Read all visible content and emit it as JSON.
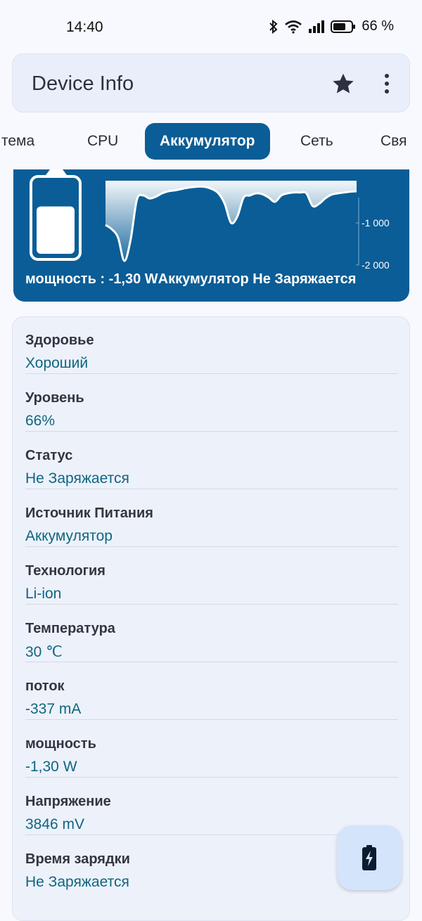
{
  "status_bar": {
    "time": "14:40",
    "battery_percent": "66 %",
    "icons": [
      "bluetooth-icon",
      "wifi-icon",
      "signal-icon",
      "battery-icon"
    ]
  },
  "app_bar": {
    "title": "Device Info",
    "actions": [
      "star-icon",
      "more-vert-icon"
    ]
  },
  "tabs": [
    {
      "label": "Система",
      "visible_label": "тема",
      "active": false
    },
    {
      "label": "CPU",
      "active": false
    },
    {
      "label": "Аккумулятор",
      "active": true
    },
    {
      "label": "Сеть",
      "active": false
    },
    {
      "label": "Связь",
      "visible_label": "Свя",
      "active": false
    }
  ],
  "battery_chart": {
    "battery_level": 0.66,
    "caption": "мощность : -1,30 WАккумулятор Не Заряжается",
    "colors": {
      "background": "#0a5d96",
      "line": "#ffffff"
    }
  },
  "chart_data": {
    "type": "area",
    "title": "",
    "xlabel": "",
    "ylabel": "",
    "ylim": [
      -2000,
      0
    ],
    "yticks": [
      {
        "value": -1000,
        "label": "-1 000"
      },
      {
        "value": -2000,
        "label": "-2 000"
      }
    ],
    "x": [
      0,
      1,
      2,
      3,
      4,
      5,
      6,
      7,
      8,
      9,
      10,
      11,
      12,
      13,
      14,
      15,
      16,
      17,
      18,
      19,
      20,
      21,
      22,
      23,
      24,
      25,
      26,
      27,
      28,
      29,
      30,
      31,
      32,
      33,
      34,
      35,
      36,
      37,
      38,
      39,
      40
    ],
    "values": [
      -1050,
      -1150,
      -1350,
      -1900,
      -1400,
      -450,
      -350,
      -420,
      -380,
      -300,
      -250,
      -230,
      -200,
      -170,
      -150,
      -140,
      -150,
      -200,
      -300,
      -550,
      -1000,
      -850,
      -400,
      -350,
      -300,
      -320,
      -400,
      -500,
      -350,
      -300,
      -280,
      -280,
      -300,
      -600,
      -550,
      -420,
      -330,
      -300,
      -280,
      -260,
      -250
    ]
  },
  "info_items": [
    {
      "label": "Здоровье",
      "value": "Хороший"
    },
    {
      "label": "Уровень",
      "value": "66%"
    },
    {
      "label": "Статус",
      "value": "Не Заряжается"
    },
    {
      "label": "Источник Питания",
      "value": "Аккумулятор"
    },
    {
      "label": "Технология",
      "value": "Li-ion"
    },
    {
      "label": "Температура",
      "value": "30 ℃"
    },
    {
      "label": "поток",
      "value": "-337 mA"
    },
    {
      "label": "мощность",
      "value": "-1,30 W"
    },
    {
      "label": "Напряжение",
      "value": "3846 mV"
    },
    {
      "label": "Время зарядки",
      "value": "Не Заряжается"
    }
  ],
  "fab": {
    "icon": "battery-charging-icon"
  }
}
